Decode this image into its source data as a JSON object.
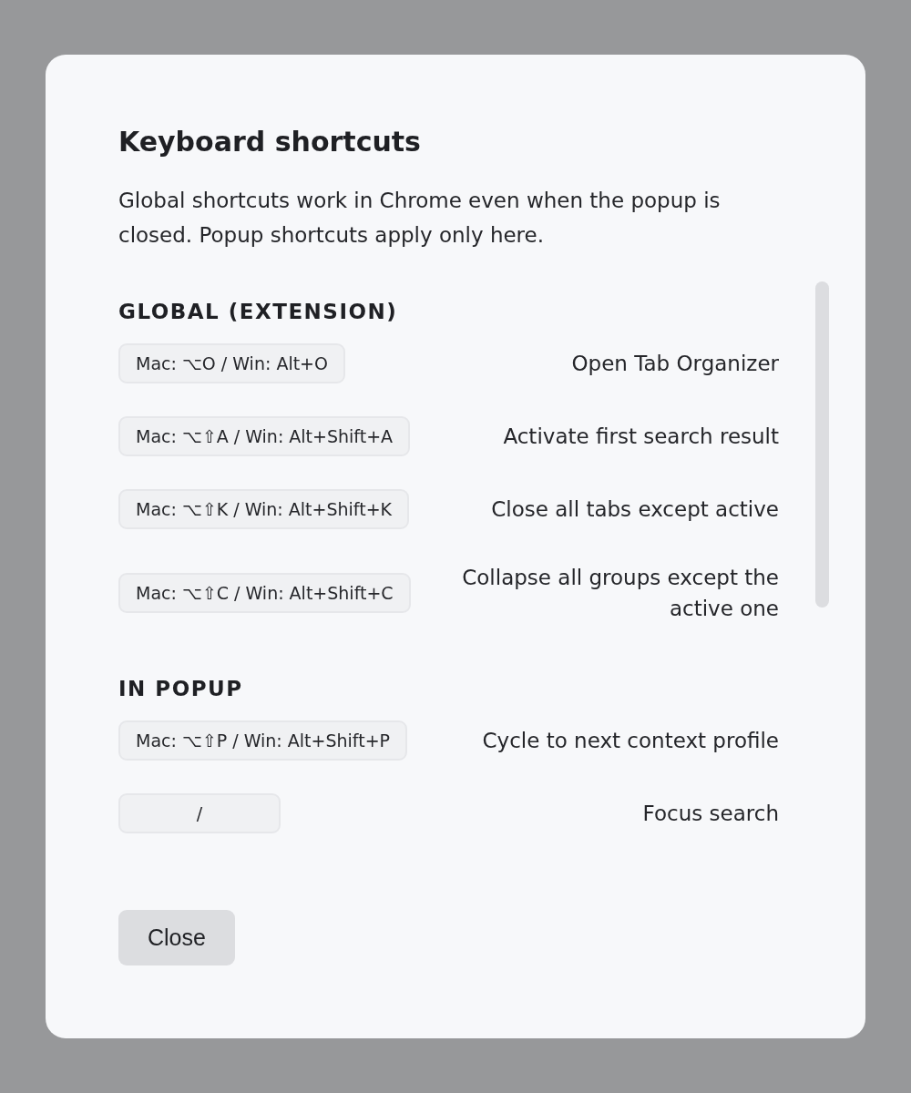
{
  "dialog": {
    "title": "Keyboard shortcuts",
    "description": "Global shortcuts work in Chrome even when the popup is closed. Popup shortcuts apply only here.",
    "sections": [
      {
        "heading": "GLOBAL (EXTENSION)",
        "shortcuts": [
          {
            "keys": "Mac: ⌥O / Win: Alt+O",
            "action": "Open Tab Organizer"
          },
          {
            "keys": "Mac: ⌥⇧A / Win: Alt+Shift+A",
            "action": "Activate first search result"
          },
          {
            "keys": "Mac: ⌥⇧K / Win: Alt+Shift+K",
            "action": "Close all tabs except active"
          },
          {
            "keys": "Mac: ⌥⇧C / Win: Alt+Shift+C",
            "action": "Collapse all groups except the active one"
          }
        ]
      },
      {
        "heading": "IN POPUP",
        "shortcuts": [
          {
            "keys": "Mac: ⌥⇧P / Win: Alt+Shift+P",
            "action": "Cycle to next context profile"
          },
          {
            "keys": "/",
            "action": "Focus search"
          }
        ]
      }
    ],
    "close_button": "Close"
  }
}
